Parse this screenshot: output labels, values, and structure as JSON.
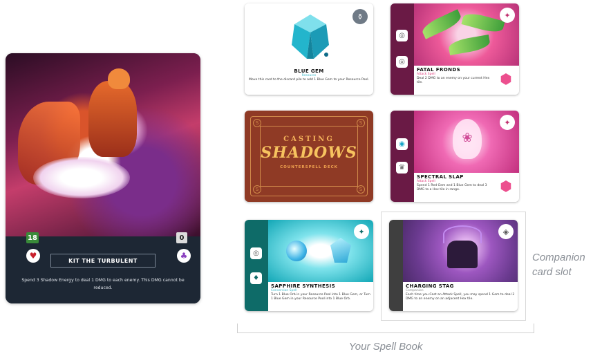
{
  "character_card": {
    "name": "KIT THE TURBULENT",
    "green_value": "18",
    "grey_value": "0",
    "ability": "Spend 3 Shadow Energy to deal 1 DMG to each enemy. This DMG cannot be reduced.",
    "icons": [
      "heart-icon",
      "shadow-energy-icon"
    ],
    "colors": {
      "green_badge": "#3a8b3a",
      "heart": "#c8202b",
      "shadow": "#8a3fbf"
    }
  },
  "spell_cards": {
    "blue_gem": {
      "title": "BLUE GEM",
      "subtype": "Resource",
      "description": "Move this card to the discard pile to add 1 Blue Gem to your Resource Pool.",
      "subtype_color": "#3db8c8"
    },
    "fatal_fronds": {
      "title": "FATAL FRONDS",
      "subtype": "Attack Spell",
      "description": "Deal 2 DMG to an enemy on your current Hex tile.",
      "subtype_color": "#e0407f"
    },
    "card_back": {
      "line1": "CASTING",
      "line2": "SHADOWS",
      "line3": "COUNTERSPELL DECK"
    },
    "spectral_slap": {
      "title": "SPECTRAL SLAP",
      "subtype": "Attack Spell",
      "description": "Spend 1 Red Gem and 1 Blue Gem to deal 3 DMG to a Hex tile in range.",
      "subtype_color": "#e0407f"
    },
    "sapphire_synthesis": {
      "title": "SAPPHIRE SYNTHESIS",
      "subtype": "Conversion Spell",
      "description": "Turn 1 Blue Orb in your Resource Pool into 1 Blue Gem, or Turn 1 Blue Gem in your Resource Pool into 1 Blue Orb.",
      "subtype_color": "#3db8c8"
    },
    "charging_stag": {
      "title": "CHARGING STAG",
      "subtype": "Companion",
      "description": "Each time you Cast an Attack Spell, you may spend 1 Gem to deal 2 DMG to an enemy on an adjacent Hex tile.",
      "subtype_color": "#888888"
    }
  },
  "labels": {
    "companion_slot": "Companion card slot",
    "spell_book": "Your Spell Book"
  }
}
